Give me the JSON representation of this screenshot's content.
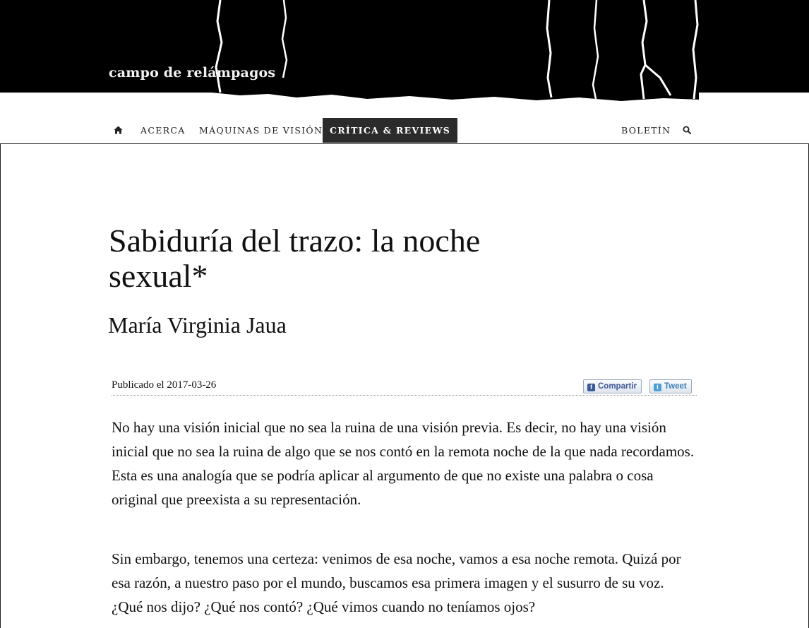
{
  "header": {
    "site_title": "campo de relámpagos"
  },
  "nav": {
    "home_icon": "home-icon",
    "items": [
      {
        "label": "ACERCA"
      },
      {
        "label": "MÁQUINAS DE VISIÓN"
      },
      {
        "label": "CRÍTICA & REVIEWS",
        "active": true
      }
    ],
    "right": {
      "newsletter_label": "BOLETÍN",
      "search_icon": "search-icon"
    }
  },
  "article": {
    "title": "Sabiduría del trazo: la noche sexual*",
    "author": "María Virginia Jaua",
    "published": "Publicado el 2017-03-26",
    "share": {
      "facebook_label": "Compartir",
      "twitter_label": "Tweet"
    },
    "paragraphs": [
      "No hay una visión inicial que no sea la ruina de una visión previa. Es decir, no hay una visión inicial que no sea la ruina de algo que se nos contó en la remota noche de la que nada recordamos. Esta es una analogía que se podría aplicar al argumento de que no existe una palabra o cosa original que preexista a su representación.",
      "Sin embargo, tenemos una certeza: venimos de esa noche, vamos a esa noche remota. Quizá por esa razón, a nuestro paso por el mundo, buscamos esa primera imagen y el susurro de su voz. ¿Qué nos dijo? ¿Qué nos contó? ¿Qué vimos cuando no teníamos ojos?"
    ]
  },
  "colors": {
    "banner_bg": "#000000",
    "active_tab_bg": "#2b2b2b",
    "facebook_blue": "#3b5998",
    "twitter_blue": "#4a9ed6"
  }
}
